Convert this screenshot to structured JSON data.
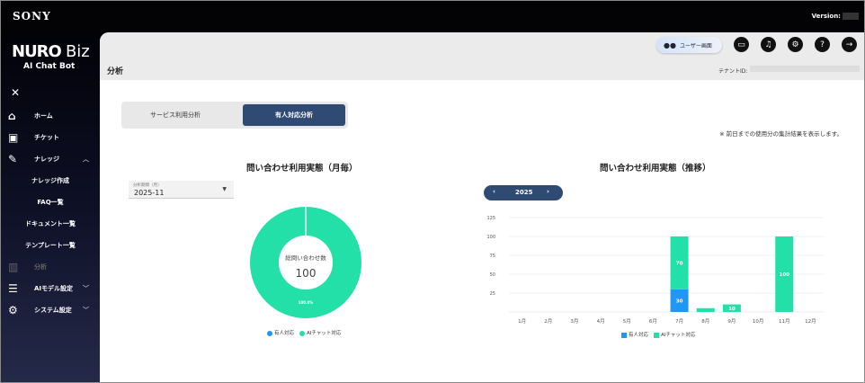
{
  "topbar": {
    "brand": "SONY",
    "version_label": "Version:"
  },
  "sidebar": {
    "brand_main": "NURO",
    "brand_biz": "Biz",
    "brand_sub": "AI Chat Bot",
    "close": "✕",
    "items": [
      {
        "label": "ホーム",
        "icon": "home-icon"
      },
      {
        "label": "チケット",
        "icon": "ticket-icon"
      },
      {
        "label": "ナレッジ",
        "icon": "edit-icon",
        "chevron": "^"
      },
      {
        "label": "ナレッジ作成",
        "sub": true
      },
      {
        "label": "FAQ一覧",
        "sub": true
      },
      {
        "label": "ドキュメント一覧",
        "sub": true
      },
      {
        "label": "テンプレート一覧",
        "sub": true
      },
      {
        "label": "分析",
        "icon": "chart-icon",
        "disabled": true
      },
      {
        "label": "AIモデル設定",
        "icon": "robot-icon",
        "chevron": "v"
      },
      {
        "label": "システム設定",
        "icon": "gear-icon",
        "chevron": "v"
      }
    ]
  },
  "header": {
    "page_title": "分析",
    "user_screen": "ユーザー画面",
    "tenant_label": "テナントID:",
    "icons": [
      "monitor-icon",
      "bell-icon",
      "user-settings-icon",
      "help-icon",
      "logout-icon"
    ]
  },
  "tabs": [
    {
      "label": "サービス利用分析",
      "active": false
    },
    {
      "label": "有人対応分析",
      "active": true
    }
  ],
  "note": "※ 前日までの使用分の集計結果を表示します。",
  "monthly": {
    "title": "問い合わせ利用実態（月毎）",
    "period_label": "分析期間（月）",
    "period_value": "2025-11",
    "center_label": "総問い合わせ数",
    "center_value": "100"
  },
  "trend": {
    "title": "問い合わせ利用実態（推移）",
    "year": "2025"
  },
  "colors": {
    "human": "#2196f3",
    "ai": "#22e0a8",
    "nav": "#2f4a73"
  },
  "chart_data": [
    {
      "type": "pie",
      "donut": true,
      "slices": [
        {
          "name": "有人対応",
          "value": 0
        },
        {
          "name": "AIチャット対応",
          "value": 100
        }
      ],
      "data_labels": [
        "100.0%"
      ],
      "legend": "bottom"
    },
    {
      "type": "bar",
      "stacked": true,
      "categories": [
        "1月",
        "2月",
        "3月",
        "4月",
        "5月",
        "6月",
        "7月",
        "8月",
        "9月",
        "10月",
        "11月",
        "12月"
      ],
      "series": [
        {
          "name": "有人対応",
          "values": [
            0,
            0,
            0,
            0,
            0,
            0,
            30,
            0,
            0,
            0,
            0,
            0
          ]
        },
        {
          "name": "AIチャット対応",
          "values": [
            0,
            0,
            0,
            0,
            0,
            0,
            70,
            5,
            10,
            0,
            100,
            0
          ]
        }
      ],
      "data_labels": {
        "7月": [
          "30",
          "70"
        ],
        "9月": [
          "10"
        ],
        "11月": [
          "100"
        ]
      },
      "yticks": [
        25,
        50,
        75,
        100,
        125
      ],
      "ylim": [
        0,
        125
      ],
      "grid": true,
      "legend": "bottom"
    }
  ]
}
